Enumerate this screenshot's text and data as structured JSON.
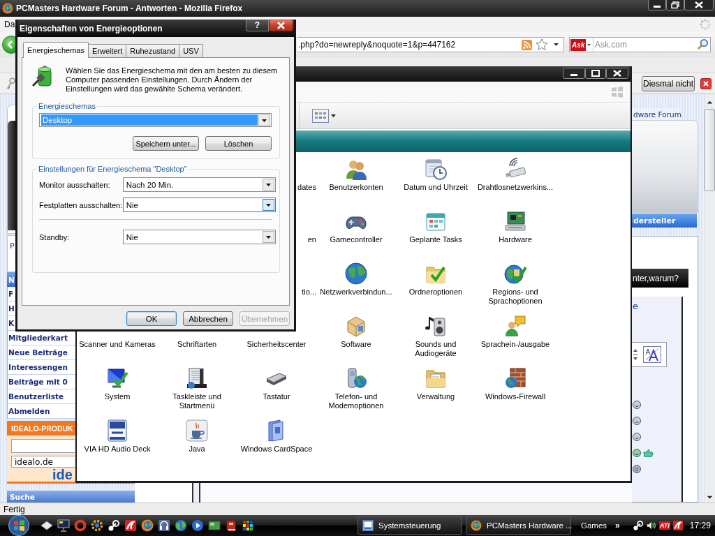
{
  "browser": {
    "title": "PCMasters Hardware Forum - Antworten - Mozilla Firefox",
    "menu": [
      "Da"
    ],
    "url": ".php?do=newreply&noquote=1&p=447162",
    "search": {
      "engine": "Ask",
      "placeholder": "Ask.com"
    },
    "notification": {
      "button": "Diesmal nicht"
    },
    "status": "Fertig"
  },
  "page": {
    "sidebar": {
      "info_text": "P",
      "nav_header": "N",
      "nav_items": [
        "F",
        "H",
        "K",
        "Mitgliederkart",
        "Neue Beiträge",
        "Interessengen",
        "Beiträge mit 0",
        "Benutzerliste",
        "Abmelden"
      ],
      "ad": {
        "title": "IDEALO-PRODUK",
        "site": "idealo.de",
        "logo": "ide"
      },
      "search_header": "Suche"
    },
    "right": {
      "tab": "dware Forum",
      "bar": "dersteller",
      "thread_title": "nter,warum?",
      "link": "e"
    }
  },
  "control_panel": {
    "items": [
      {
        "label": "dates",
        "kind": "clipped"
      },
      {
        "label": "Benutzerkonten",
        "kind": "item"
      },
      {
        "label": "Datum und Uhrzeit",
        "kind": "item"
      },
      {
        "label": "Drahtlosnetzwerkins...",
        "kind": "item"
      },
      {
        "label": "en",
        "kind": "clipped"
      },
      {
        "label": "Gamecontroller",
        "kind": "item"
      },
      {
        "label": "Geplante Tasks",
        "kind": "item"
      },
      {
        "label": "Hardware",
        "kind": "item"
      },
      {
        "label": "tio...",
        "kind": "clipped"
      },
      {
        "label": "Netzwerkverbindun...",
        "kind": "item"
      },
      {
        "label": "Ordneroptionen",
        "kind": "item"
      },
      {
        "label": "Regions- und Sprachoptionen",
        "kind": "item"
      },
      {
        "label": "Scanner und Kameras",
        "kind": "label"
      },
      {
        "label": "Schriftarten",
        "kind": "label"
      },
      {
        "label": "Sicherheitscenter",
        "kind": "label"
      },
      {
        "label": "Software",
        "kind": "item"
      },
      {
        "label": "Sounds und Audiogeräte",
        "kind": "item"
      },
      {
        "label": "Sprachein-/ausgabe",
        "kind": "item"
      },
      {
        "label": "System",
        "kind": "item"
      },
      {
        "label": "Taskleiste und Startmenü",
        "kind": "item"
      },
      {
        "label": "Tastatur",
        "kind": "item"
      },
      {
        "label": "Telefon- und Modemoptionen",
        "kind": "item"
      },
      {
        "label": "Verwaltung",
        "kind": "item"
      },
      {
        "label": "Windows-Firewall",
        "kind": "item"
      },
      {
        "label": "VIA HD Audio Deck",
        "kind": "item"
      },
      {
        "label": "Java",
        "kind": "item"
      },
      {
        "label": "Windows CardSpace",
        "kind": "item"
      }
    ]
  },
  "dialog": {
    "title": "Eigenschaften von Energieoptionen",
    "help": "?",
    "tabs": [
      {
        "label": "Energieschemas",
        "selected": true
      },
      {
        "label": "Erweitert",
        "selected": false
      },
      {
        "label": "Ruhezustand",
        "selected": false
      },
      {
        "label": "USV",
        "selected": false
      }
    ],
    "description": "Wählen Sie das Energieschema mit den am besten zu diesem Computer passenden Einstellungen. Durch Ändern der Einstellungen wird das gewählte Schema verändert.",
    "schemes": {
      "legend": "Energieschemas",
      "dropdown": {
        "value": "Desktop",
        "selected": true
      },
      "buttons": [
        "Speichern unter...",
        "Löschen"
      ]
    },
    "settings": {
      "legend": "Einstellungen für Energieschema \"Desktop\"",
      "groups": [
        [
          {
            "label": "Monitor ausschalten:",
            "value": "Nach 20 Min.",
            "focused": false
          },
          {
            "label": "Festplatten ausschalten:",
            "value": "Nie",
            "focused": true
          }
        ],
        [
          {
            "label": "Standby:",
            "value": "Nie",
            "focused": false
          }
        ]
      ]
    },
    "buttons": [
      {
        "label": "OK",
        "default": true,
        "disabled": false
      },
      {
        "label": "Abbrechen",
        "default": false,
        "disabled": false
      },
      {
        "label": "Übernehmen",
        "default": false,
        "disabled": true
      }
    ]
  },
  "taskbar": {
    "tasks": [
      {
        "label": "Systemsteuerung",
        "selected": false
      },
      {
        "label": "PCMasters Hardware ...",
        "selected": false
      }
    ],
    "toolbar": {
      "label": "Games",
      "chevron": "»"
    },
    "tray_badge": "ATI",
    "clock": "17:29"
  }
}
